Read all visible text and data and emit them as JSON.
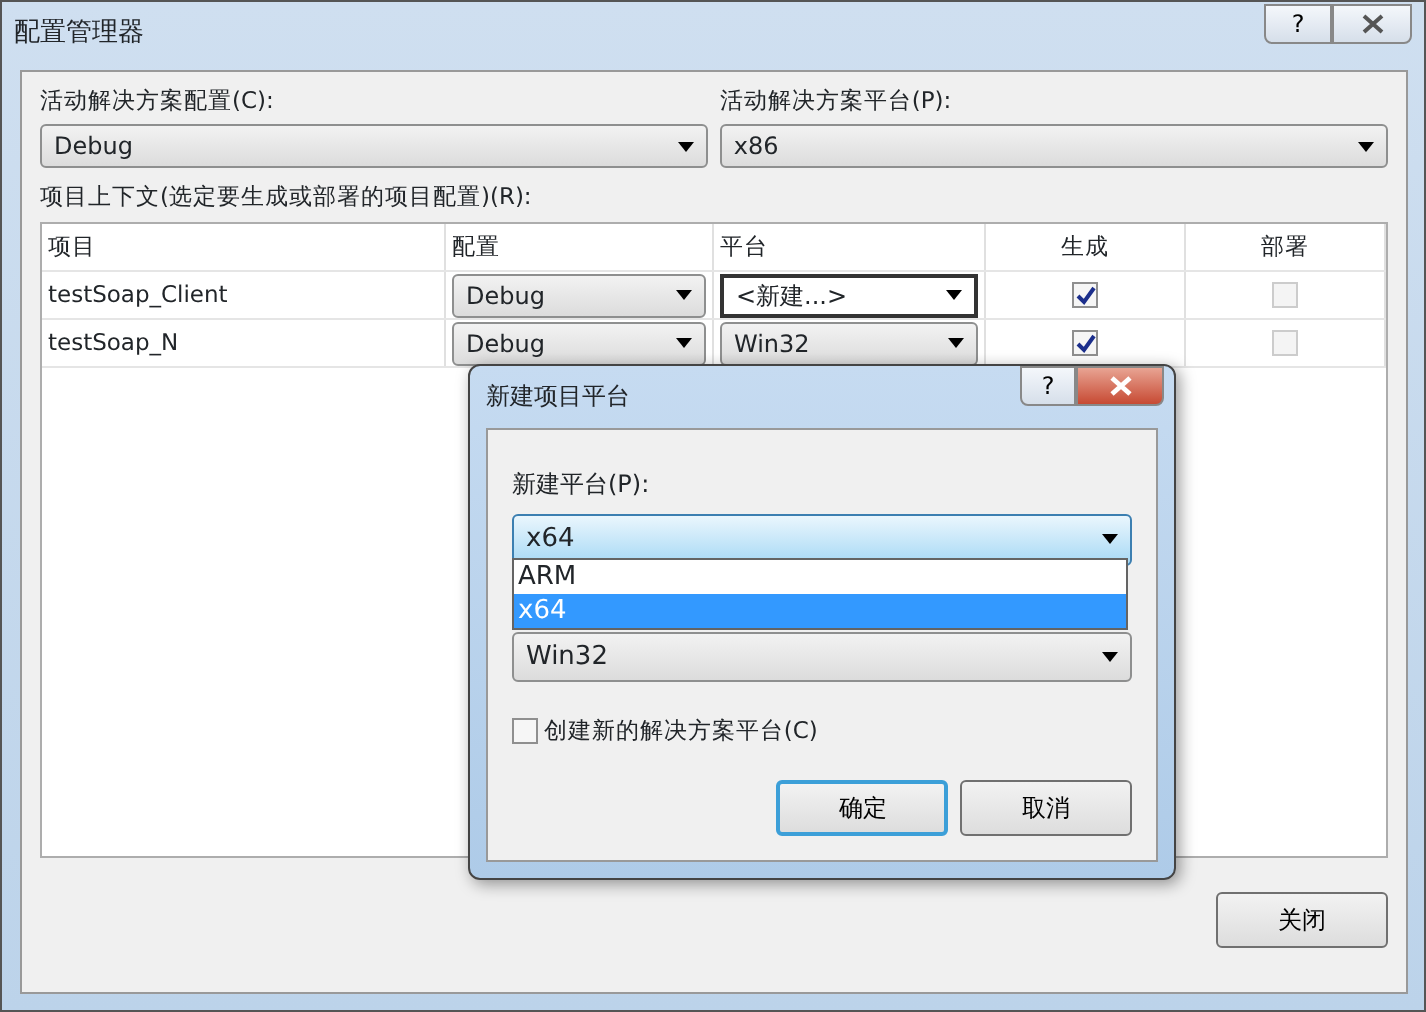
{
  "window": {
    "title": "配置管理器",
    "help": "?"
  },
  "active_config": {
    "label": "活动解决方案配置(C):",
    "value": "Debug"
  },
  "active_platform": {
    "label": "活动解决方案平台(P):",
    "value": "x86"
  },
  "context_label": "项目上下文(选定要生成或部署的项目配置)(R):",
  "table": {
    "columns": [
      "项目",
      "配置",
      "平台",
      "生成",
      "部署"
    ],
    "rows": [
      {
        "project": "testSoap_Client",
        "config": "Debug",
        "platform": "<新建...>",
        "platform_focused": true,
        "build": true,
        "deploy": false
      },
      {
        "project": "testSoap_N",
        "config": "Debug",
        "platform": "Win32",
        "platform_focused": false,
        "build": true,
        "deploy": false
      }
    ]
  },
  "close_button": "关闭",
  "dialog": {
    "title": "新建项目平台",
    "help": "?",
    "new_platform": {
      "label": "新建平台(P):",
      "value": "x64",
      "options": [
        {
          "label": "ARM",
          "selected": false
        },
        {
          "label": "x64",
          "selected": true
        }
      ]
    },
    "copy_from": {
      "value": "Win32"
    },
    "create_solution_platform": {
      "label": "创建新的解决方案平台(C)",
      "checked": false
    },
    "buttons": [
      {
        "label": "确定",
        "default": true
      },
      {
        "label": "取消",
        "default": false
      }
    ]
  }
}
